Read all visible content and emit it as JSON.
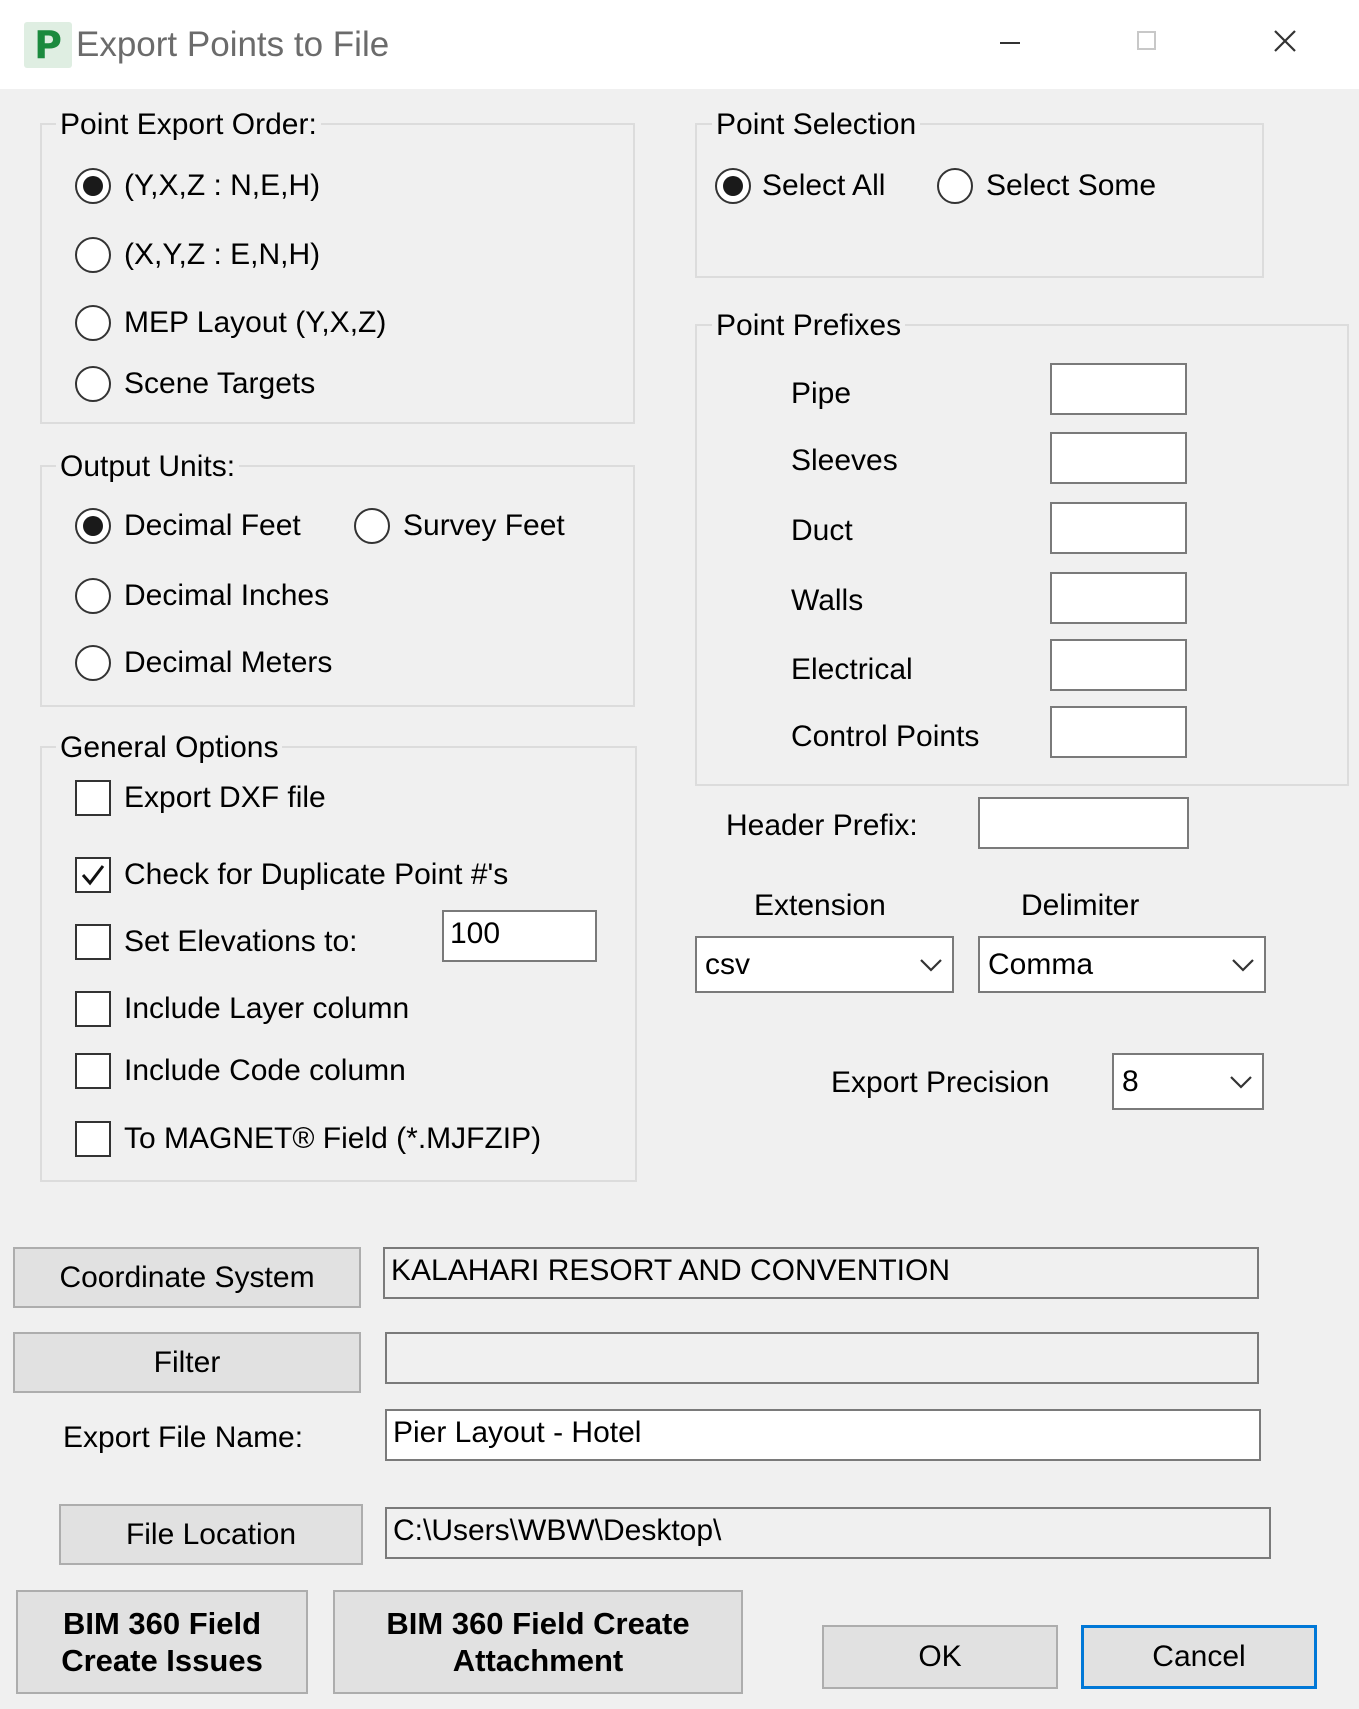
{
  "window": {
    "icon_letter": "P",
    "title": "Export Points to File",
    "minimize_label": "minimize",
    "maximize_label": "maximize",
    "close_label": "close"
  },
  "point_export_order": {
    "legend": "Point Export Order:",
    "options": [
      "(Y,X,Z  :  N,E,H)",
      "(X,Y,Z  :  E,N,H)",
      "MEP Layout (Y,X,Z)",
      "Scene Targets"
    ],
    "selected": "(Y,X,Z  :  N,E,H)"
  },
  "output_units": {
    "legend": "Output Units:",
    "options": [
      "Decimal Feet",
      "Survey Feet",
      "Decimal Inches",
      "Decimal Meters"
    ],
    "selected": "Decimal Feet"
  },
  "general_options": {
    "legend": "General Options",
    "export_dxf": {
      "label": "Export DXF file",
      "checked": false
    },
    "check_duplicates": {
      "label": "Check for Duplicate Point #'s",
      "checked": true
    },
    "set_elevations": {
      "label": "Set Elevations to:",
      "checked": false,
      "value": "100"
    },
    "include_layer": {
      "label": "Include Layer column",
      "checked": false
    },
    "include_code": {
      "label": "Include Code column",
      "checked": false
    },
    "to_magnet": {
      "label": "To MAGNET® Field (*.MJFZIP)",
      "checked": false
    }
  },
  "point_selection": {
    "legend": "Point Selection",
    "options": [
      "Select All",
      "Select Some"
    ],
    "selected": "Select All"
  },
  "point_prefixes": {
    "legend": "Point Prefixes",
    "items": [
      {
        "label": "Pipe",
        "value": ""
      },
      {
        "label": "Sleeves",
        "value": ""
      },
      {
        "label": "Duct",
        "value": ""
      },
      {
        "label": "Walls",
        "value": ""
      },
      {
        "label": "Electrical",
        "value": ""
      },
      {
        "label": "Control Points",
        "value": ""
      }
    ]
  },
  "header_prefix": {
    "label": "Header Prefix:",
    "value": ""
  },
  "extension": {
    "label": "Extension",
    "value": "csv"
  },
  "delimiter": {
    "label": "Delimiter",
    "value": "Comma"
  },
  "export_precision": {
    "label": "Export Precision",
    "value": "8"
  },
  "coordinate_system": {
    "button_label": "Coordinate System",
    "value": "KALAHARI RESORT AND CONVENTION"
  },
  "filter": {
    "button_label": "Filter",
    "value": ""
  },
  "export_file_name": {
    "label": "Export File Name:",
    "value": "Pier Layout - Hotel"
  },
  "file_location": {
    "button_label": "File Location",
    "value": "C:\\Users\\WBW\\Desktop\\"
  },
  "buttons": {
    "bim_issues_line1": "BIM 360 Field",
    "bim_issues_line2": "Create Issues",
    "bim_attach_line1": "BIM 360 Field Create",
    "bim_attach_line2": "Attachment",
    "ok": "OK",
    "cancel": "Cancel"
  },
  "icons": {
    "radio_on": "radio-selected-icon",
    "radio_off": "radio-unselected-icon",
    "check_on": "checkmark-icon",
    "dropdown": "chevron-down-icon"
  }
}
